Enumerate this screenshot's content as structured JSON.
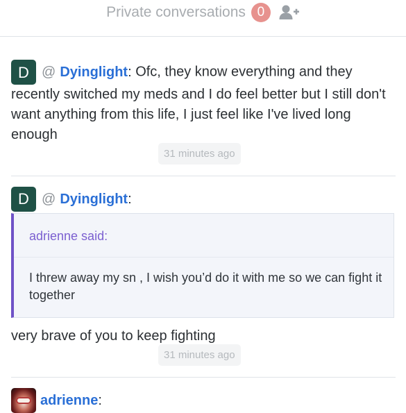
{
  "header": {
    "title": "Private conversations",
    "count": "0",
    "add_icon": "add-user-icon"
  },
  "messages": [
    {
      "avatar_letter": "D",
      "mention": "@",
      "username": "Dyinglight",
      "colon": ":",
      "text_lead": " Ofc, they know everything and they",
      "text_rest": "recently switched my meds and I do feel better but I still don't want anything from this life, I just feel like I've lived long enough",
      "time": "31 minutes ago"
    },
    {
      "avatar_letter": "D",
      "mention": "@",
      "username": "Dyinglight",
      "colon": ":",
      "quote_attribution": "adrienne said:",
      "quote_text": "I threw away my sn , I wish you’d do it with me so we can fight it together",
      "text": "very brave of you to keep fighting",
      "time": "31 minutes ago"
    },
    {
      "avatar_icon": "user-photo-avatar",
      "username": "adrienne",
      "colon": ":"
    }
  ]
}
